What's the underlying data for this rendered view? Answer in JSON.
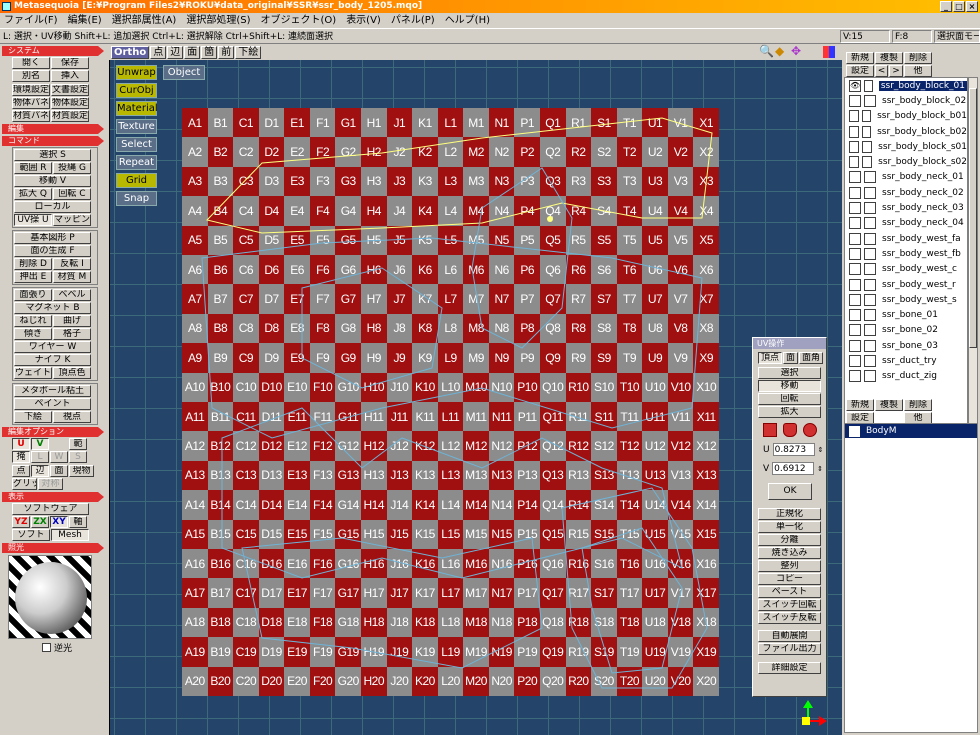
{
  "window": {
    "title": "Metasequoia [E:¥Program Files2¥ROKU¥data_original¥SSR¥ssr_body_1205.mqo]",
    "controls": [
      "_",
      "□",
      "×"
    ]
  },
  "menu": [
    "ファイル(F)",
    "編集(E)",
    "選択部属性(A)",
    "選択部処理(S)",
    "オブジェクト(O)",
    "表示(V)",
    "パネル(P)",
    "ヘルプ(H)"
  ],
  "hint": {
    "text": "L: 選択・UV移動  Shift+L: 追加選択  Ctrl+L: 選択解除  Ctrl+Shift+L: 連続面選択",
    "vertex": "V:15",
    "face": "F:8",
    "mode": "選択面モード"
  },
  "left": {
    "system_title": "システム",
    "system": [
      "開く",
      "保存",
      "別名",
      "挿入",
      "環境設定",
      "文書設定",
      "物体パネル",
      "物体設定",
      "材質パネル",
      "材質設定"
    ],
    "edit_title": "編集",
    "command_title": "コマンド",
    "select": [
      "選択 S",
      "範囲 R",
      "投縄 G",
      "移動 V",
      "拡大 Q",
      "回転 C",
      "ローカル",
      "UV操 U",
      "マッピング"
    ],
    "create": [
      "基本図形 P",
      "面の生成 F",
      "削除 D",
      "反転 I",
      "押出 E",
      "材質 M"
    ],
    "modify": [
      "面張り",
      "ベベル",
      "マグネット B",
      "ねじれ",
      "曲げ",
      "傾き",
      "格子",
      "ワイヤー W",
      "ナイフ K",
      "ウェイト",
      "頂点色"
    ],
    "other": [
      "メタボール粘土",
      "ペイント",
      "下絵",
      "視点"
    ],
    "editopt_title": "編集オプション",
    "editopt": [
      "U",
      "V",
      "範",
      "掩",
      "L",
      "W",
      "S",
      "点",
      "辺",
      "面",
      "現物",
      "グリッド",
      "対称"
    ],
    "display_title": "表示",
    "display": [
      "ソフトウェア",
      "YZ",
      "ZX",
      "XY",
      "軸",
      "ソフト",
      "Mesh"
    ],
    "light_title": "照光",
    "light_check": "逆光"
  },
  "viewtop": {
    "tabs": [
      "Ortho",
      "点",
      "辺",
      "面",
      "箇",
      "前",
      "下絵"
    ]
  },
  "viewport": {
    "tools": [
      "Unwrap",
      "CurObj",
      "Material",
      "Texture",
      "Select",
      "Repeat",
      "Grid",
      "Snap"
    ],
    "object_button": "Object",
    "columns": [
      "A",
      "B",
      "C",
      "D",
      "E",
      "F",
      "G",
      "H",
      "J",
      "K",
      "L",
      "M",
      "N",
      "P",
      "Q",
      "R",
      "S",
      "T",
      "U",
      "V",
      "X"
    ],
    "rows": 20,
    "highlight_color": "#ffff80",
    "wire_color": "#6fb3d6"
  },
  "uv_panel": {
    "title": "UV操作",
    "modes": [
      "頂点",
      "面",
      "面角"
    ],
    "ops": [
      "選択",
      "移動",
      "回転",
      "拡大"
    ],
    "u_label": "U",
    "u_value": "0.8273",
    "v_label": "V",
    "v_value": "0.6912",
    "ok": "OK",
    "actions": [
      "正規化",
      "単一化",
      "分離",
      "焼き込み",
      "整列",
      "コピー",
      "ペースト",
      "スイッチ回転",
      "スイッチ反転"
    ],
    "auto": [
      "自動展開",
      "ファイル出力"
    ],
    "detail": "詳細設定"
  },
  "right": {
    "obj_buttons": [
      "新規",
      "複製",
      "削除",
      "設定",
      "<",
      ">",
      "他"
    ],
    "objects": [
      "ssr_body_block_01",
      "ssr_body_block_02",
      "ssr_body_block_b01",
      "ssr_body_block_b02",
      "ssr_body_block_s01",
      "ssr_body_block_s02",
      "ssr_body_neck_01",
      "ssr_body_neck_02",
      "ssr_body_neck_03",
      "ssr_body_neck_04",
      "ssr_body_west_fa",
      "ssr_body_west_fb",
      "ssr_body_west_c",
      "ssr_body_west_r",
      "ssr_body_west_s",
      "ssr_bone_01",
      "ssr_bone_02",
      "ssr_bone_03",
      "ssr_duct_try",
      "ssr_duct_zig"
    ],
    "mat_buttons": [
      "新規",
      "複製",
      "削除",
      "設定",
      "他"
    ],
    "materials": [
      "BodyM"
    ]
  }
}
